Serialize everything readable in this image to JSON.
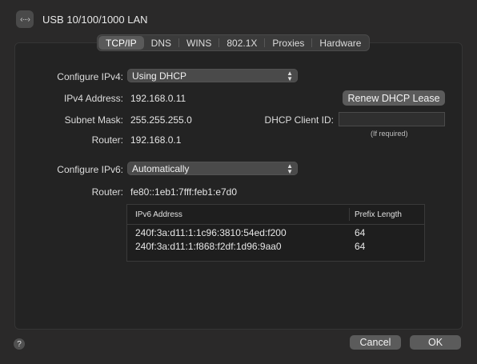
{
  "window": {
    "title": "USB 10/100/1000 LAN",
    "icon": "network-ethernet-icon"
  },
  "tabs": [
    {
      "label": "TCP/IP",
      "active": true
    },
    {
      "label": "DNS"
    },
    {
      "label": "WINS"
    },
    {
      "label": "802.1X"
    },
    {
      "label": "Proxies"
    },
    {
      "label": "Hardware"
    }
  ],
  "ipv4": {
    "configure_label": "Configure IPv4:",
    "configure_value": "Using DHCP",
    "address_label": "IPv4 Address:",
    "address_value": "192.168.0.11",
    "subnet_label": "Subnet Mask:",
    "subnet_value": "255.255.255.0",
    "router_label": "Router:",
    "router_value": "192.168.0.1",
    "renew_button": "Renew DHCP Lease",
    "client_id_label": "DHCP Client ID:",
    "client_id_value": "",
    "client_id_hint": "(If required)"
  },
  "ipv6": {
    "configure_label": "Configure IPv6:",
    "configure_value": "Automatically",
    "router_label": "Router:",
    "router_value": "fe80::1eb1:7fff:feb1:e7d0",
    "table": {
      "headers": [
        "IPv6 Address",
        "Prefix Length"
      ],
      "rows": [
        [
          "240f:3a:d11:1:1c96:3810:54ed:f200",
          "64"
        ],
        [
          "240f:3a:d11:1:f868:f2df:1d96:9aa0",
          "64"
        ]
      ]
    }
  },
  "footer": {
    "help_label": "?",
    "cancel_label": "Cancel",
    "ok_label": "OK"
  }
}
